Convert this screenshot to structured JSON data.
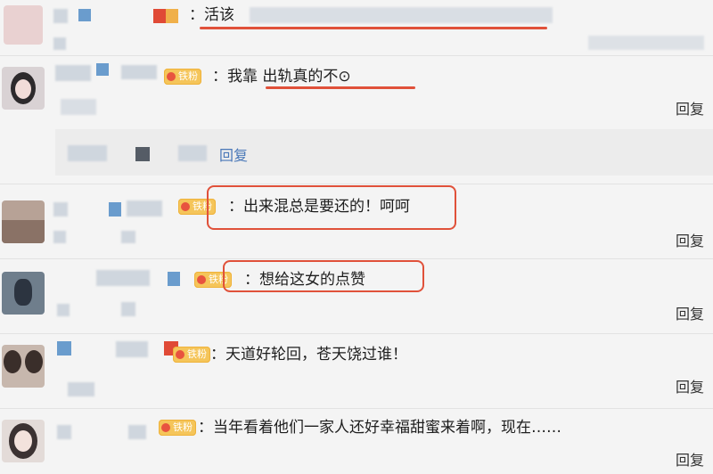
{
  "comments": [
    {
      "badge": "",
      "text": "活该",
      "reply": ""
    },
    {
      "badge": "铁粉",
      "text": "我靠 出轨真的不⊙",
      "reply": "回复"
    },
    {
      "badge": "",
      "text": "",
      "reply": "回复"
    },
    {
      "badge": "铁粉",
      "text": "出来混总是要还的！呵呵",
      "reply": "回复"
    },
    {
      "badge": "铁粉",
      "text": "想给这女的点赞",
      "reply": "回复"
    },
    {
      "badge": "铁粉",
      "text": "天道好轮回，苍天饶过谁！",
      "reply": "回复"
    },
    {
      "badge": "铁粉",
      "text": "当年看着他们一家人还好幸福甜蜜来着啊，现在……",
      "reply": "回复"
    }
  ],
  "colors": {
    "highlight": "#e0513a",
    "badge": "#f5c55a",
    "link": "#4a78b8"
  },
  "icons": [
    "avatar",
    "badge-icon"
  ]
}
